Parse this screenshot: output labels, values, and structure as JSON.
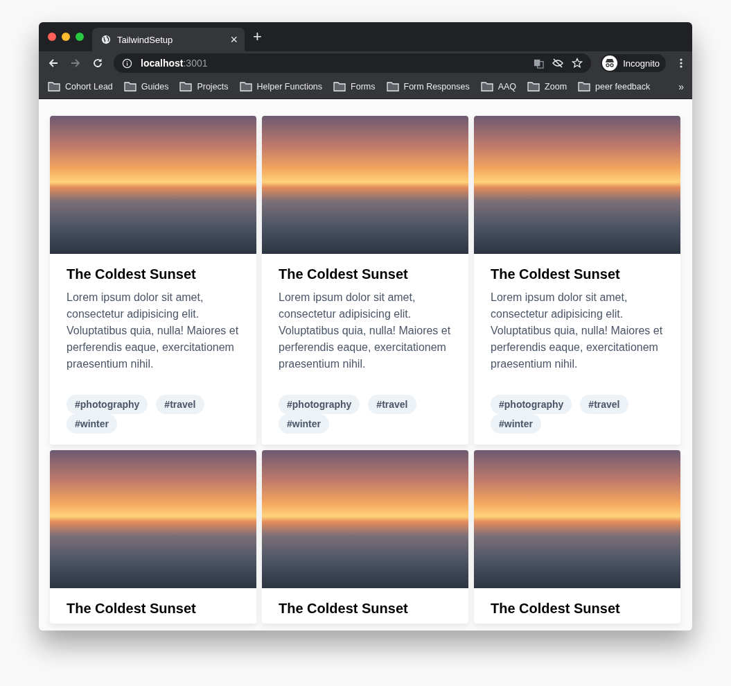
{
  "tab": {
    "title": "TailwindSetup",
    "close": "×"
  },
  "new_tab": "+",
  "nav": [
    {
      "kind": "back",
      "disabled": false
    },
    {
      "kind": "forward",
      "disabled": true
    },
    {
      "kind": "reload",
      "disabled": false
    }
  ],
  "address": {
    "host": "localhost",
    "port": ":3001"
  },
  "profile": {
    "label": "Incognito"
  },
  "bookmarks": [
    "Cohort Lead",
    "Guides",
    "Projects",
    "Helper Functions",
    "Forms",
    "Form Responses",
    "AAQ",
    "Zoom",
    "peer feedback"
  ],
  "bookmarks_more": "»",
  "cards": [
    {
      "title": "The Coldest Sunset",
      "body": "Lorem ipsum dolor sit amet, consectetur adipisicing elit. Voluptatibus quia, nulla! Maiores et perferendis eaque, exercitationem praesentium nihil.",
      "tags": [
        "#photography",
        "#travel",
        "#winter"
      ]
    },
    {
      "title": "The Coldest Sunset",
      "body": "Lorem ipsum dolor sit amet, consectetur adipisicing elit. Voluptatibus quia, nulla! Maiores et perferendis eaque, exercitationem praesentium nihil.",
      "tags": [
        "#photography",
        "#travel",
        "#winter"
      ]
    },
    {
      "title": "The Coldest Sunset",
      "body": "Lorem ipsum dolor sit amet, consectetur adipisicing elit. Voluptatibus quia, nulla! Maiores et perferendis eaque, exercitationem praesentium nihil.",
      "tags": [
        "#photography",
        "#travel",
        "#winter"
      ]
    },
    {
      "title": "The Coldest Sunset"
    },
    {
      "title": "The Coldest Sunset"
    },
    {
      "title": "The Coldest Sunset"
    }
  ]
}
